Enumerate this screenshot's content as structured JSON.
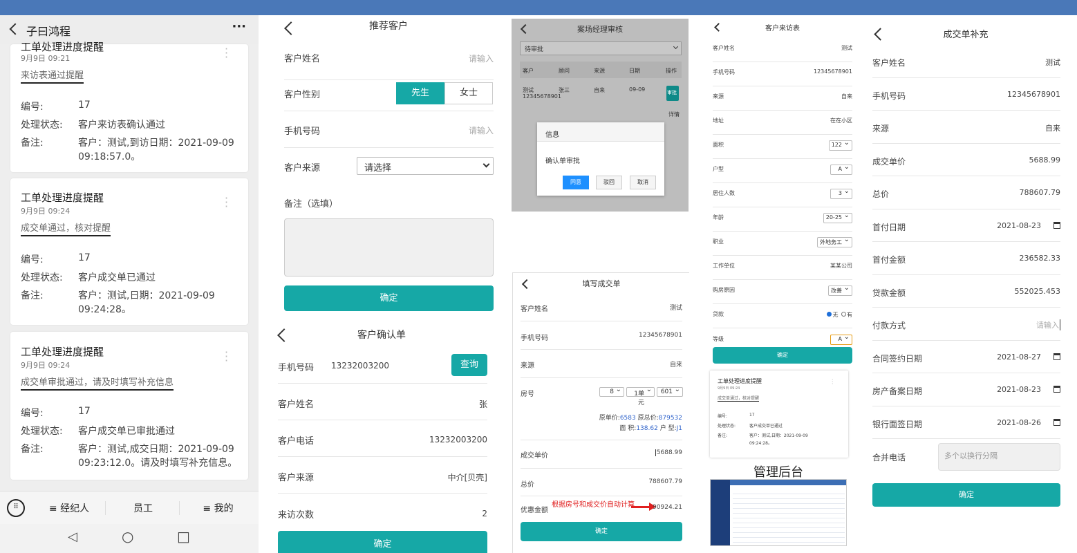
{
  "colors": {
    "accent": "#16a8a6",
    "banner": "#4a78b8",
    "red": "#e02020",
    "link": "#3366cc"
  },
  "p1": {
    "title": "子曰鸿程",
    "more": "···",
    "partial_title": "工单处理进度提醒",
    "partial_time": "9月9日 09:21",
    "partial_sub": "来访表通过提醒",
    "labels": {
      "no": "编号:",
      "status": "处理状态:",
      "remark": "备注:"
    },
    "partial_no": "17",
    "partial_status": "客户来访表确认通过",
    "partial_remark1": "客户：测试,到访日期：2021-09-09",
    "partial_remark2": "09:18:57.0。",
    "cards": [
      {
        "title": "工单处理进度提醒",
        "time": "9月9日 09:24",
        "sub": "成交单通过，核对提醒",
        "no": "17",
        "status": "客户成交单已通过",
        "remark1": "客户：测试,日期：2021-09-09",
        "remark2": "09:24:28。"
      },
      {
        "title": "工单处理进度提醒",
        "time": "9月9日 09:24",
        "sub": "成交单审批通过，请及时填写补充信息",
        "no": "17",
        "status": "客户成交单已审批通过",
        "remark1": "客户：测试,成交日期：2021-09-09",
        "remark2": "09:23:12.0。请及时填写补充信息。"
      }
    ],
    "tabs": [
      "≡ 经纪人",
      "员工",
      "≡ 我的"
    ],
    "nav": [
      "◁",
      "○",
      "□"
    ]
  },
  "p2": {
    "title": "推荐客户",
    "name_label": "客户姓名",
    "name_ph": "请输入",
    "gender_label": "客户性别",
    "male": "先生",
    "female": "女士",
    "phone_label": "手机号码",
    "phone_ph": "请输入",
    "source_label": "客户来源",
    "source_value": "请选择",
    "remark_label": "备注（选填）",
    "submit": "确定"
  },
  "p3": {
    "title": "客户确认单",
    "phone_label": "手机号码",
    "phone_value": "13232003200",
    "query": "查询",
    "name_label": "客户姓名",
    "name_value": "张",
    "tel_label": "客户电话",
    "tel_value": "13232003200",
    "source_label": "客户来源",
    "source_value": "中介[贝壳]",
    "visits_label": "来访次数",
    "visits_value": "2",
    "submit": "确定"
  },
  "p4": {
    "title": "案场经理审核",
    "filter": "待审批",
    "headers": [
      "客户",
      "顾问",
      "来源",
      "日期",
      "操作"
    ],
    "row": {
      "customer": "测试",
      "phone": "12345678901",
      "advisor": "张三",
      "source": "自来",
      "date": "09-09",
      "approve": "审批",
      "detail": "详情"
    },
    "dialog": {
      "title": "信息",
      "body": "确认单审批",
      "agree": "同意",
      "reject": "驳回",
      "cancel": "取消"
    }
  },
  "p5": {
    "title": "填写成交单",
    "name_label": "客户姓名",
    "name_value": "测试",
    "phone_label": "手机号码",
    "phone_value": "12345678901",
    "source_label": "来源",
    "source_value": "自来",
    "room_label": "房号",
    "room_sel": [
      "8",
      "1单元",
      "601"
    ],
    "orig_unit_label": "原单价:",
    "orig_unit": "6583",
    "orig_total_label": "原总价:",
    "orig_total": "879532",
    "area_label": "面 积:",
    "area": "138.62",
    "type_label": "户 型:",
    "type": "J1",
    "unit_label": "成交单价",
    "unit_value": "5688.99",
    "total_label": "总价",
    "total_value": "788607.79",
    "discount_label": "优惠金额",
    "discount_note": "根据房号和成交价自动计算",
    "discount_value": "90924.21",
    "submit": "确定"
  },
  "p6": {
    "title": "客户来访表",
    "rows": [
      {
        "label": "客户姓名",
        "value": "测试"
      },
      {
        "label": "手机号码",
        "value": "12345678901"
      },
      {
        "label": "来源",
        "value": "自来"
      },
      {
        "label": "地址",
        "value": "在在小区"
      },
      {
        "label": "面积",
        "sel": "122"
      },
      {
        "label": "户型",
        "sel": "A"
      },
      {
        "label": "居住人数",
        "sel": "3"
      },
      {
        "label": "年龄",
        "sel": "20-25"
      },
      {
        "label": "职业",
        "sel": "外地务工"
      },
      {
        "label": "工作单位",
        "value": "某某公司"
      },
      {
        "label": "购房原因",
        "sel": "改善"
      },
      {
        "label": "贷款",
        "radio1": "无",
        "radio2": "有"
      },
      {
        "label": "等级",
        "sel": "A"
      }
    ],
    "submit": "确定",
    "card": {
      "title": "工单处理进度提醒",
      "time": "9月9日 09:24",
      "sub": "成交单通过，核对提醒",
      "no_label": "编号:",
      "no": "17",
      "status_label": "处理状态:",
      "status": "客户成交单已通过",
      "remark_label": "备注:",
      "remark1": "客户：测试,日期：2021-09-09",
      "remark2": "09:24:28。"
    },
    "admin": "管理后台"
  },
  "p7": {
    "title": "成交单补充",
    "rows": [
      {
        "label": "客户姓名",
        "value": "测试"
      },
      {
        "label": "手机号码",
        "value": "12345678901"
      },
      {
        "label": "来源",
        "value": "自来"
      },
      {
        "label": "成交单价",
        "value": "5688.99"
      },
      {
        "label": "总价",
        "value": "788607.79"
      },
      {
        "label": "首付日期",
        "value": "2021-08-23",
        "cal": true
      },
      {
        "label": "首付金额",
        "value": "236582.33"
      },
      {
        "label": "贷款金额",
        "value": "552025.453"
      },
      {
        "label": "付款方式",
        "value": "请输入",
        "ph": true
      },
      {
        "label": "合同签约日期",
        "value": "2021-08-27",
        "cal": true
      },
      {
        "label": "房产备案日期",
        "value": "2021-08-23",
        "cal": true
      },
      {
        "label": "银行面签日期",
        "value": "2021-08-26",
        "cal": true
      }
    ],
    "phone_label": "合并电话",
    "phone_ph": "多个以换行分隔",
    "submit": "确定"
  }
}
